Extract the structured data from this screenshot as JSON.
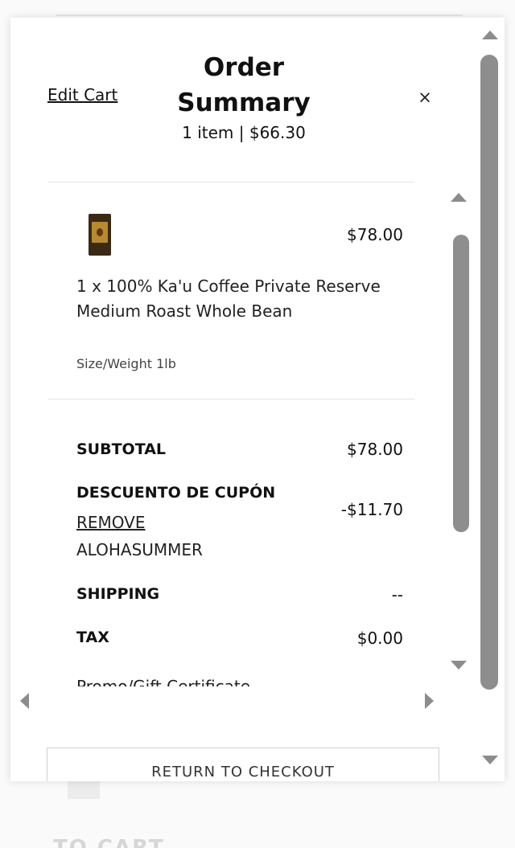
{
  "background": {
    "partial_text": "TO CART"
  },
  "header": {
    "edit_cart_label": "Edit Cart",
    "title_line1": "Order",
    "title_line2": "Summary",
    "subtitle": "1 item | $66.30",
    "close_glyph": "×"
  },
  "product": {
    "price": "$78.00",
    "name": "1 x 100% Ka'u Coffee Private Reserve Medium Roast Whole Bean",
    "meta": "Size/Weight 1lb",
    "image_icon": "coffee-bag-icon"
  },
  "totals": {
    "subtotal_label": "SUBTOTAL",
    "subtotal_value": "$78.00",
    "coupon_label": "DESCUENTO DE CUPÓN",
    "coupon_value": "-$11.70",
    "remove_label": "REMOVE",
    "coupon_code": "ALOHASUMMER",
    "shipping_label": "SHIPPING",
    "shipping_value": "--",
    "tax_label": "TAX",
    "tax_value": "$0.00",
    "promo_label": "Promo/Gift Certificate"
  },
  "footer": {
    "return_button_label": "RETURN TO CHECKOUT"
  },
  "colors": {
    "scrollbar_thumb": "#8e8e8e",
    "scroll_arrow": "#8c8c8c",
    "text": "#111111"
  }
}
